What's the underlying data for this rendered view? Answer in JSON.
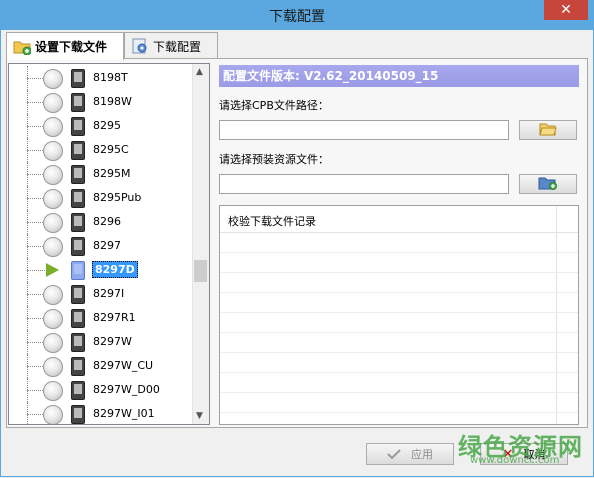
{
  "window": {
    "title": "下载配置",
    "close_glyph": "✕"
  },
  "tabs": [
    {
      "label": "设置下载文件",
      "active": true,
      "icon": "folder-add-icon"
    },
    {
      "label": "下载配置",
      "active": false,
      "icon": "gear-config-icon"
    }
  ],
  "tree": {
    "items": [
      {
        "label": "8198T",
        "selected": false
      },
      {
        "label": "8198W",
        "selected": false
      },
      {
        "label": "8295",
        "selected": false
      },
      {
        "label": "8295C",
        "selected": false
      },
      {
        "label": "8295M",
        "selected": false
      },
      {
        "label": "8295Pub",
        "selected": false
      },
      {
        "label": "8296",
        "selected": false
      },
      {
        "label": "8297",
        "selected": false
      },
      {
        "label": "8297D",
        "selected": true
      },
      {
        "label": "8297I",
        "selected": false
      },
      {
        "label": "8297R1",
        "selected": false
      },
      {
        "label": "8297W",
        "selected": false
      },
      {
        "label": "8297W_CU",
        "selected": false
      },
      {
        "label": "8297W_D00",
        "selected": false
      },
      {
        "label": "8297W_I01",
        "selected": false
      }
    ]
  },
  "config": {
    "version_header": "配置文件版本: V2.62_20140509_15",
    "cpb_label": "请选择CPB文件路径：",
    "cpb_value": "",
    "preload_label": "请选择预装资源文件：",
    "preload_value": "",
    "log_header": "校验下载文件记录"
  },
  "buttons": {
    "apply": "应用",
    "cancel": "取消"
  },
  "watermark": {
    "main": "绿色资源网",
    "sub": "www.downcc.com"
  },
  "colors": {
    "title_bar": "#5aa8df",
    "header_bar": "#9a9ae6",
    "selection": "#3399ff",
    "play": "#7cae2b"
  }
}
